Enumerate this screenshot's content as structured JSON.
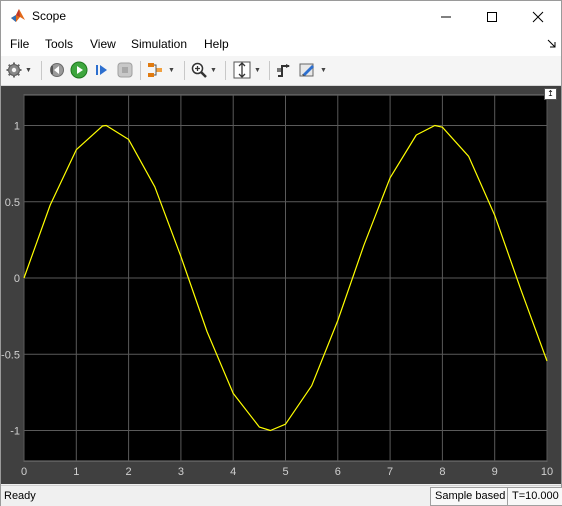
{
  "window": {
    "title": "Scope"
  },
  "menu": {
    "items": [
      "File",
      "Tools",
      "View",
      "Simulation",
      "Help"
    ]
  },
  "toolbar": {
    "icons": [
      "settings-icon",
      "step-back-icon",
      "run-icon",
      "step-forward-icon",
      "stop-icon",
      "signal-selector-icon",
      "zoom-in-icon",
      "scale-axes-icon",
      "triggers-icon",
      "style-icon"
    ]
  },
  "chart_data": {
    "type": "line",
    "series": [
      {
        "x": [
          0,
          0.5,
          1,
          1.5,
          1.571,
          2,
          2.5,
          3,
          3.5,
          4,
          4.5,
          4.712,
          5,
          5.5,
          6,
          6.5,
          7,
          7.5,
          7.854,
          8,
          8.5,
          9,
          9.5,
          10
        ],
        "y": [
          0,
          0.479,
          0.841,
          0.997,
          1,
          0.909,
          0.598,
          0.141,
          -0.351,
          -0.757,
          -0.978,
          -1,
          -0.959,
          -0.706,
          -0.279,
          0.215,
          0.657,
          0.938,
          1,
          0.989,
          0.798,
          0.412,
          -0.075,
          -0.544
        ],
        "color": "#ffff00"
      }
    ],
    "xlim": [
      0,
      10
    ],
    "ylim": [
      -1.2,
      1.2
    ],
    "xticks": [
      "0",
      "1",
      "2",
      "3",
      "4",
      "5",
      "6",
      "7",
      "8",
      "9",
      "10"
    ],
    "yticks": [
      "1",
      "0.5",
      "0",
      "-0.5",
      "-1"
    ],
    "ytick_values": [
      1,
      0.5,
      0,
      -0.5,
      -1
    ],
    "grid": true,
    "background": "#000000",
    "grid_color": "#5a5a5a",
    "tick_color": "#d0d0d0"
  },
  "status": {
    "ready": "Ready",
    "mode": "Sample based",
    "time": "T=10.000"
  }
}
